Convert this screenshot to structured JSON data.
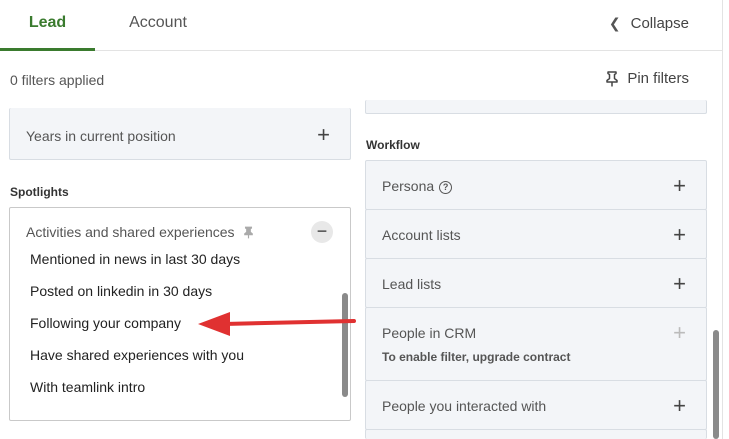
{
  "tabs": [
    {
      "label": "Lead",
      "active": true
    },
    {
      "label": "Account",
      "active": false
    }
  ],
  "collapse_label": "Collapse",
  "filters_applied": "0 filters applied",
  "pin_filters_label": "Pin filters",
  "left": {
    "years_in_position": "Years in current position",
    "spotlights_title": "Spotlights",
    "spotlight_header": "Activities and shared experiences",
    "options": [
      "Mentioned in news in last 30 days",
      "Posted on linkedin in 30 days",
      "Following your company",
      "Have shared experiences with you",
      "With teamlink intro"
    ]
  },
  "right": {
    "workflow_title": "Workflow",
    "items": {
      "persona": "Persona",
      "account_lists": "Account lists",
      "lead_lists": "Lead lists",
      "people_in_crm": "People in CRM",
      "upgrade_note": "To enable filter, upgrade contract",
      "people_interacted": "People you interacted with"
    }
  },
  "colors": {
    "accent_green": "#3a7b2e",
    "arrow_red": "#e03131",
    "filter_bg": "#f3f5f8"
  }
}
